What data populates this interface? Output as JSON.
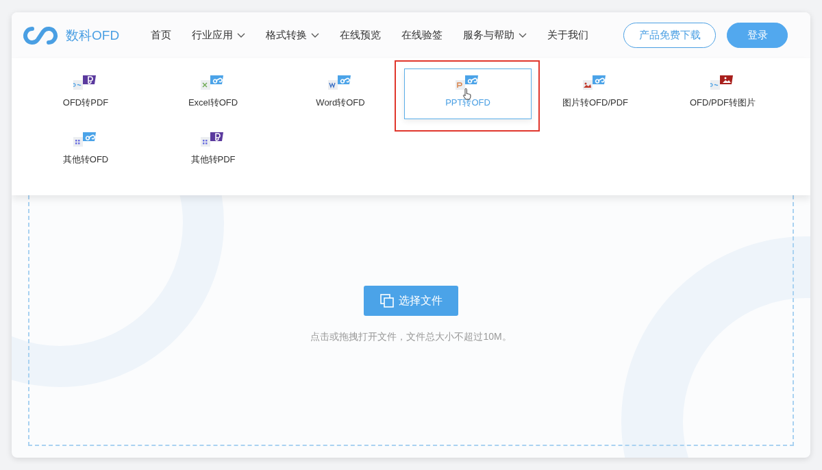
{
  "logo": {
    "text": "数科OFD"
  },
  "nav": [
    {
      "label": "首页",
      "dropdown": false
    },
    {
      "label": "行业应用",
      "dropdown": true
    },
    {
      "label": "格式转换",
      "dropdown": true
    },
    {
      "label": "在线预览",
      "dropdown": false
    },
    {
      "label": "在线验签",
      "dropdown": false
    },
    {
      "label": "服务与帮助",
      "dropdown": true
    },
    {
      "label": "关于我们",
      "dropdown": false
    }
  ],
  "header_buttons": [
    {
      "kind": "outline",
      "label": "产品免费下载"
    },
    {
      "kind": "solid",
      "label": "登录"
    }
  ],
  "conversions": [
    {
      "label": "OFD转PDF",
      "kind": "ofdpdf",
      "selected": false,
      "highlighted": false
    },
    {
      "label": "Excel转OFD",
      "kind": "excelofd",
      "selected": false,
      "highlighted": false
    },
    {
      "label": "Word转OFD",
      "kind": "wordofd",
      "selected": false,
      "highlighted": false
    },
    {
      "label": "PPT转OFD",
      "kind": "pptofd",
      "selected": true,
      "highlighted": true
    },
    {
      "label": "图片转OFD/PDF",
      "kind": "imageofd",
      "selected": false,
      "highlighted": false
    },
    {
      "label": "OFD/PDF转图片",
      "kind": "ofdimage",
      "selected": false,
      "highlighted": false
    },
    {
      "label": "其他转OFD",
      "kind": "otherofd",
      "selected": false,
      "highlighted": false
    },
    {
      "label": "其他转PDF",
      "kind": "otherpdf",
      "selected": false,
      "highlighted": false
    }
  ],
  "upload": {
    "button": "选择文件",
    "hint": "点击或拖拽打开文件，文件总大小不超过10M。"
  }
}
